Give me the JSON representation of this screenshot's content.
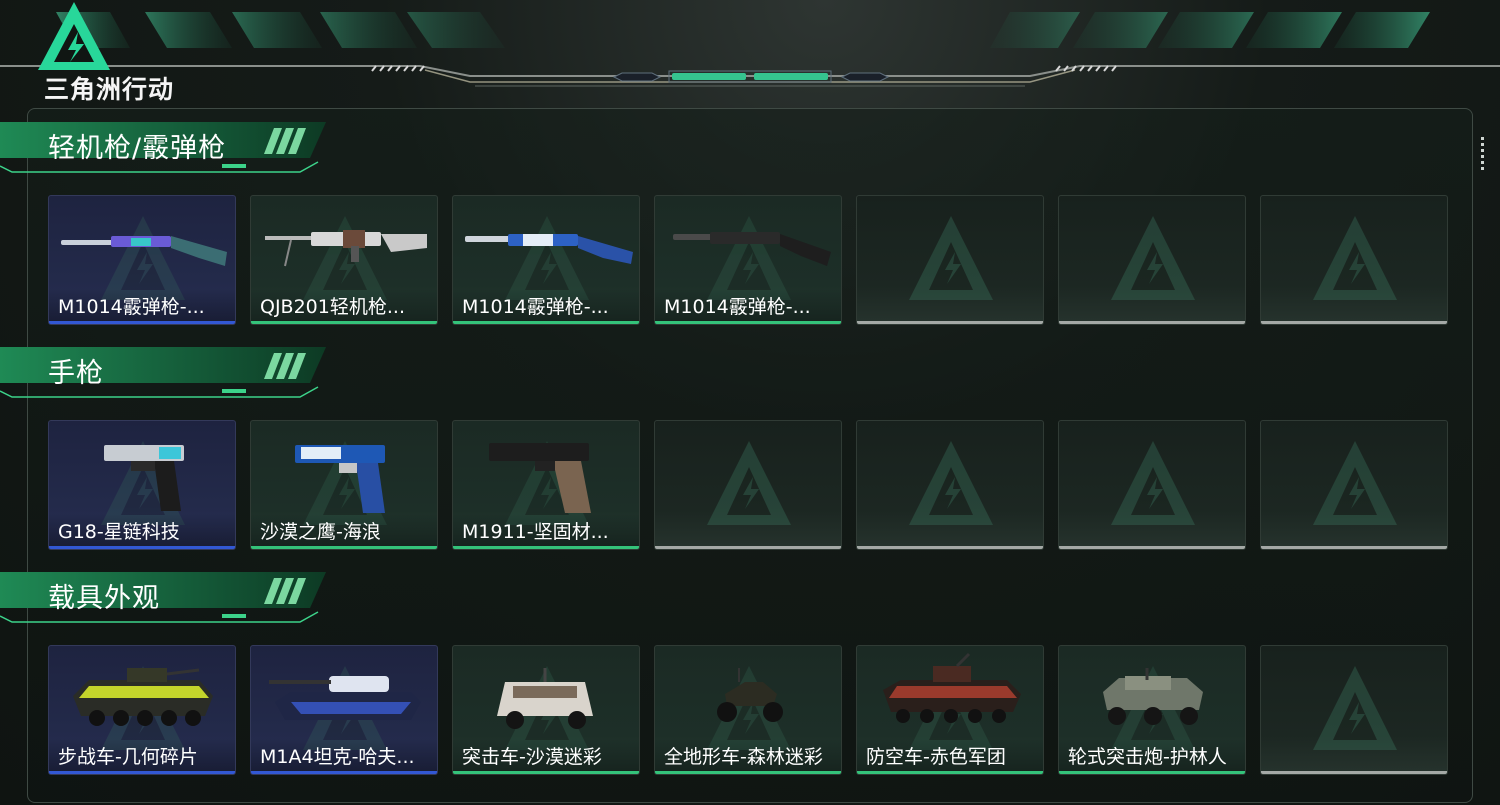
{
  "app": {
    "logo_text": "三角洲行动",
    "accent": "#34c37a",
    "blue_rarity": "#3258d4",
    "empty_color": "#a4a9a6"
  },
  "sections": [
    {
      "title": "轻机枪/霰弹枪",
      "cards": [
        {
          "name": "M1014霰弹枪-...",
          "rarity": "blue",
          "icon": "shotgun-purple"
        },
        {
          "name": "QJB201轻机枪...",
          "rarity": "green",
          "icon": "lmg-white"
        },
        {
          "name": "M1014霰弹枪-...",
          "rarity": "green",
          "icon": "shotgun-blue"
        },
        {
          "name": "M1014霰弹枪-...",
          "rarity": "green",
          "icon": "shotgun-black"
        },
        {
          "name": "",
          "rarity": "empty",
          "icon": "empty-slot"
        },
        {
          "name": "",
          "rarity": "empty",
          "icon": "empty-slot"
        },
        {
          "name": "",
          "rarity": "empty",
          "icon": "empty-slot"
        }
      ]
    },
    {
      "title": "手枪",
      "cards": [
        {
          "name": "G18-星链科技",
          "rarity": "blue",
          "icon": "pistol-g18"
        },
        {
          "name": "沙漠之鹰-海浪",
          "rarity": "green",
          "icon": "pistol-deagle"
        },
        {
          "name": "M1911-坚固材...",
          "rarity": "green",
          "icon": "pistol-m1911"
        },
        {
          "name": "",
          "rarity": "empty",
          "icon": "empty-slot"
        },
        {
          "name": "",
          "rarity": "empty",
          "icon": "empty-slot"
        },
        {
          "name": "",
          "rarity": "empty",
          "icon": "empty-slot"
        },
        {
          "name": "",
          "rarity": "empty",
          "icon": "empty-slot"
        }
      ]
    },
    {
      "title": "载具外观",
      "cards": [
        {
          "name": "步战车-几何碎片",
          "rarity": "blue",
          "icon": "ifv-yellow"
        },
        {
          "name": "M1A4坦克-哈夫...",
          "rarity": "blue",
          "icon": "tank-blue"
        },
        {
          "name": "突击车-沙漠迷彩",
          "rarity": "green",
          "icon": "assault-vehicle"
        },
        {
          "name": "全地形车-森林迷彩",
          "rarity": "green",
          "icon": "atv"
        },
        {
          "name": "防空车-赤色军团",
          "rarity": "green",
          "icon": "aa-vehicle"
        },
        {
          "name": "轮式突击炮-护林人",
          "rarity": "green",
          "icon": "wheeled-gun"
        },
        {
          "name": "",
          "rarity": "empty",
          "icon": "empty-slot"
        }
      ]
    }
  ]
}
